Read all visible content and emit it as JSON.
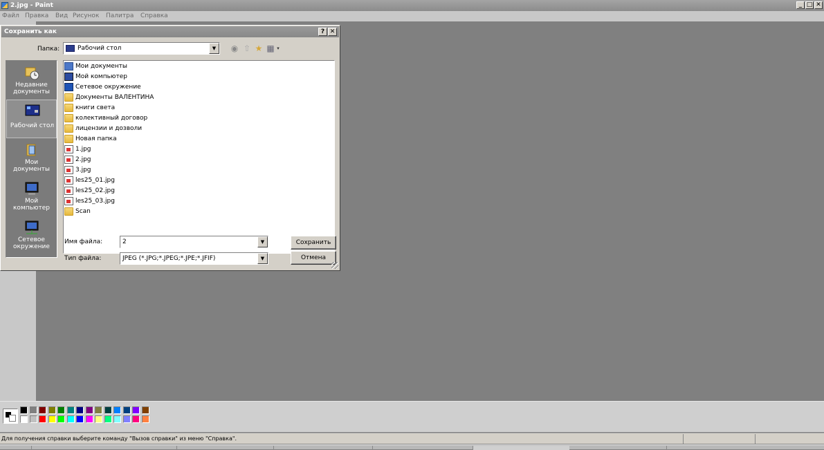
{
  "window": {
    "title": "2.jpg - Paint",
    "minimize": "_",
    "maximize": "□",
    "close": "✕"
  },
  "menu": [
    "Файл",
    "Правка",
    "Вид",
    "Рисунок",
    "Палитра",
    "Справка"
  ],
  "dialog": {
    "title": "Сохранить как",
    "help": "?",
    "close": "✕",
    "folder_label": "Папка:",
    "folder_value": "Рабочий стол",
    "places": [
      {
        "label": "Недавние документы",
        "icon": "recent-documents-icon"
      },
      {
        "label": "Рабочий стол",
        "icon": "desktop-icon"
      },
      {
        "label": "Мои документы",
        "icon": "my-documents-icon"
      },
      {
        "label": "Мой компьютер",
        "icon": "my-computer-icon"
      },
      {
        "label": "Сетевое окружение",
        "icon": "network-places-icon"
      }
    ],
    "files": [
      {
        "name": "Мои документы",
        "icon": "mydocs"
      },
      {
        "name": "Мой компьютер",
        "icon": "mycomp"
      },
      {
        "name": "Сетевое окружение",
        "icon": "network"
      },
      {
        "name": "Документы ВАЛЕНТИНА",
        "icon": "folder"
      },
      {
        "name": "книги света",
        "icon": "folder"
      },
      {
        "name": "колективный договор",
        "icon": "folder"
      },
      {
        "name": "лицензии и дозволи",
        "icon": "folder"
      },
      {
        "name": "Новая папка",
        "icon": "folder"
      },
      {
        "name": "1.jpg",
        "icon": "jpg"
      },
      {
        "name": "2.jpg",
        "icon": "jpg"
      },
      {
        "name": "3.jpg",
        "icon": "jpg"
      },
      {
        "name": "les25_01.jpg",
        "icon": "jpg"
      },
      {
        "name": "les25_02.jpg",
        "icon": "jpg"
      },
      {
        "name": "les25_03.jpg",
        "icon": "jpg"
      },
      {
        "name": "Scan",
        "icon": "folder"
      }
    ],
    "filename_label": "Имя файла:",
    "filename_value": "2",
    "filetype_label": "Тип файла:",
    "filetype_value": "JPEG (*.JPG;*.JPEG;*.JPE;*.JFIF)",
    "save_button": "Сохранить",
    "cancel_button": "Отмена",
    "dropdown_arrow": "▼"
  },
  "palette": {
    "top_row": [
      "#000000",
      "#808080",
      "#800000",
      "#808000",
      "#008000",
      "#008080",
      "#000080",
      "#800080",
      "#808040",
      "#004040",
      "#0080ff",
      "#004080",
      "#8000ff",
      "#804000"
    ],
    "bottom_row": [
      "#ffffff",
      "#c0c0c0",
      "#ff0000",
      "#ffff00",
      "#00ff00",
      "#00ffff",
      "#0000ff",
      "#ff00ff",
      "#ffff80",
      "#00ff80",
      "#80ffff",
      "#8080ff",
      "#ff0080",
      "#ff8040"
    ]
  },
  "status": {
    "text": "Для получения справки выберите команду \"Вызов справки\" из меню \"Справка\"."
  }
}
